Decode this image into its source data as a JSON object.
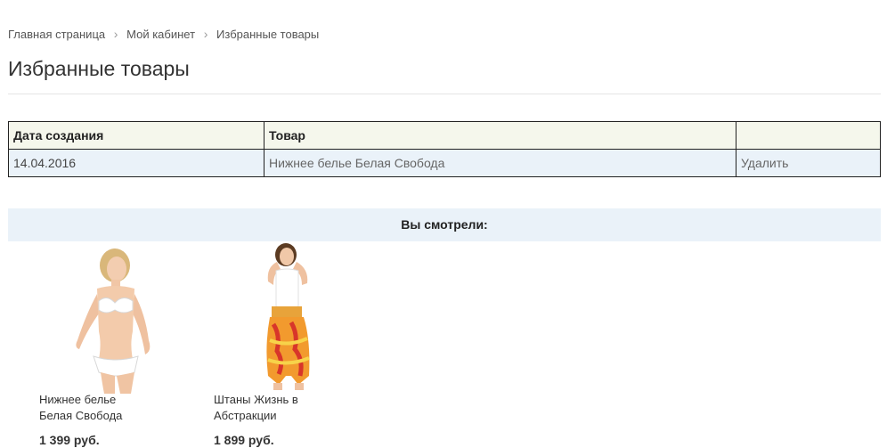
{
  "breadcrumb": {
    "items": [
      "Главная страница",
      "Мой кабинет",
      "Избранные товары"
    ],
    "separator": "›"
  },
  "page": {
    "title": "Избранные товары"
  },
  "wishlist": {
    "headers": {
      "date": "Дата создания",
      "product": "Товар",
      "action": ""
    },
    "rows": [
      {
        "date": "14.04.2016",
        "product": "Нижнее белье Белая Свобода",
        "action": "Удалить"
      }
    ]
  },
  "viewed": {
    "heading": "Вы смотрели:",
    "items": [
      {
        "name": "Нижнее белье Белая Свобода",
        "price": "1 399 руб.",
        "image_icon": "product-photo-lingerie-icon"
      },
      {
        "name": "Штаны Жизнь в Абстракции",
        "price": "1 899 руб.",
        "image_icon": "product-photo-pants-icon"
      }
    ]
  },
  "colors": {
    "header_bg": "#f5f7ec",
    "row_bg": "#eaf2f9",
    "viewed_bar_bg": "#eaf2f9",
    "text": "#333333"
  }
}
